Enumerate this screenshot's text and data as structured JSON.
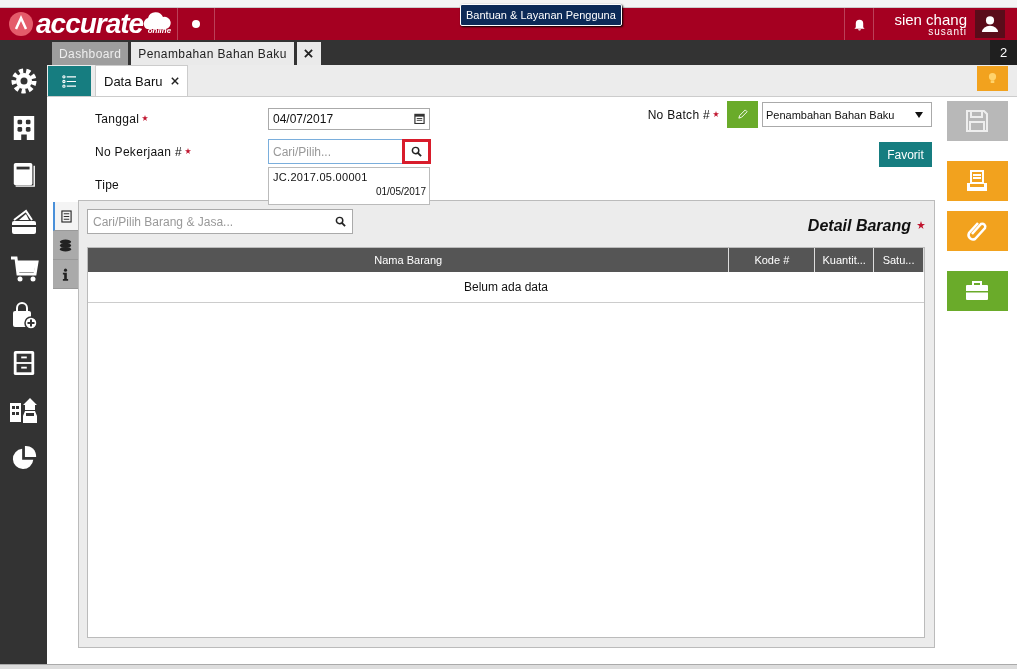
{
  "header": {
    "logo_text": "accurate",
    "logo_sub": "online",
    "tooltip": "Bantuan & Layanan Pengguna",
    "user_name": "sien chang",
    "user_sub": "susanti"
  },
  "doc_tabs": [
    {
      "label": "Dashboard",
      "selected": false
    },
    {
      "label": "Penambahan Bahan Baku",
      "selected": true
    }
  ],
  "tab_count": "2",
  "form_tabs": [
    {
      "label": "Data Baru",
      "selected": true
    }
  ],
  "fields": [
    {
      "label": "Tanggal",
      "required": true,
      "kind": "date",
      "value": "04/07/2017"
    },
    {
      "label": "No Pekerjaan #",
      "required": true,
      "kind": "search",
      "placeholder": "Cari/Pilih..."
    },
    {
      "label": "Tipe",
      "kind": "none"
    }
  ],
  "suggestion": {
    "code": "JC.2017.05.00001",
    "date": "01/05/2017"
  },
  "batch": {
    "label": "No Batch #",
    "required": true,
    "value": "Penambahan Bahan Baku"
  },
  "favorit": "Favorit",
  "side_tabs": [
    {
      "kind": "list",
      "selected": true
    },
    {
      "kind": "coins",
      "selected": false
    },
    {
      "kind": "info",
      "selected": false
    }
  ],
  "detail": {
    "search_placeholder": "Cari/Pilih Barang & Jasa...",
    "title": "Detail Barang",
    "required": true,
    "columns": [
      "Nama Barang",
      "Kode #",
      "Kuantit...",
      "Satu..."
    ],
    "empty": "Belum ada data"
  },
  "actions": [
    {
      "kind": "save",
      "disabled": true
    },
    {
      "kind": "print",
      "disabled": false
    },
    {
      "kind": "attach",
      "disabled": false
    },
    {
      "kind": "tools",
      "disabled": false
    }
  ]
}
